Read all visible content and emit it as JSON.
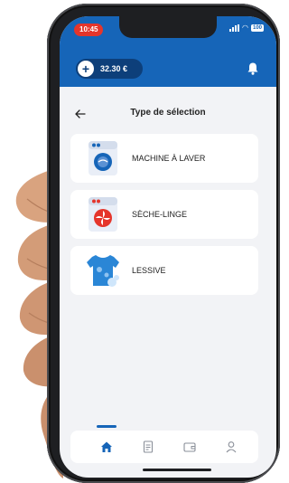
{
  "status": {
    "time": "10:45",
    "battery": "100"
  },
  "header": {
    "balance": "32.30 €"
  },
  "page": {
    "title": "Type de sélection"
  },
  "options": [
    {
      "label": "MACHINE À LAVER",
      "icon": "washing-machine-icon"
    },
    {
      "label": "SÈCHE-LINGE",
      "icon": "dryer-icon"
    },
    {
      "label": "LESSIVE",
      "icon": "detergent-shirt-icon"
    }
  ],
  "nav": {
    "items": [
      "home-icon",
      "document-icon",
      "wallet-icon",
      "profile-icon"
    ],
    "active": "home-icon"
  },
  "colors": {
    "primary": "#1665b8",
    "dark_primary": "#0d3f7a",
    "status_red": "#e5352b",
    "background": "#f2f3f6"
  }
}
